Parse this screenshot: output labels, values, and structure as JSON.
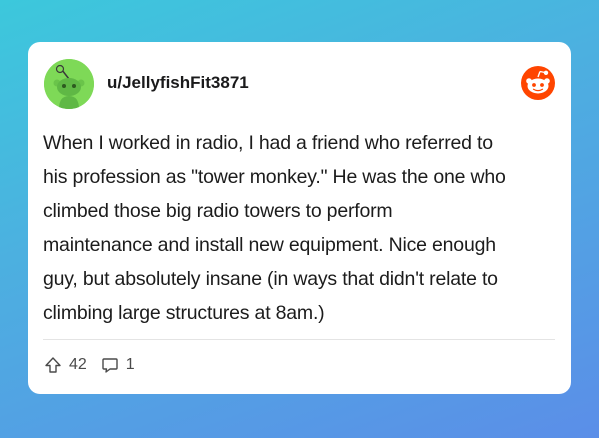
{
  "post": {
    "username": "u/JellyfishFit3871",
    "lines": [
      "When I worked in radio, I had a friend who referred to",
      "his profession as \"tower monkey.\" He was the one who",
      "climbed those big radio towers to perform",
      "maintenance and install new equipment. Nice enough",
      "guy, but absolutely insane (in ways that didn't relate to",
      "climbing large structures at 8am.)"
    ],
    "upvotes": "42",
    "comments": "1"
  },
  "icons": {
    "avatar": "reddit-snoo-avatar",
    "brand": "reddit-logo-icon",
    "upvote": "upvote-arrow-icon",
    "comment": "comment-bubble-icon"
  },
  "colors": {
    "avatar_bg": "#7ed957",
    "brand_orange": "#ff4500"
  }
}
